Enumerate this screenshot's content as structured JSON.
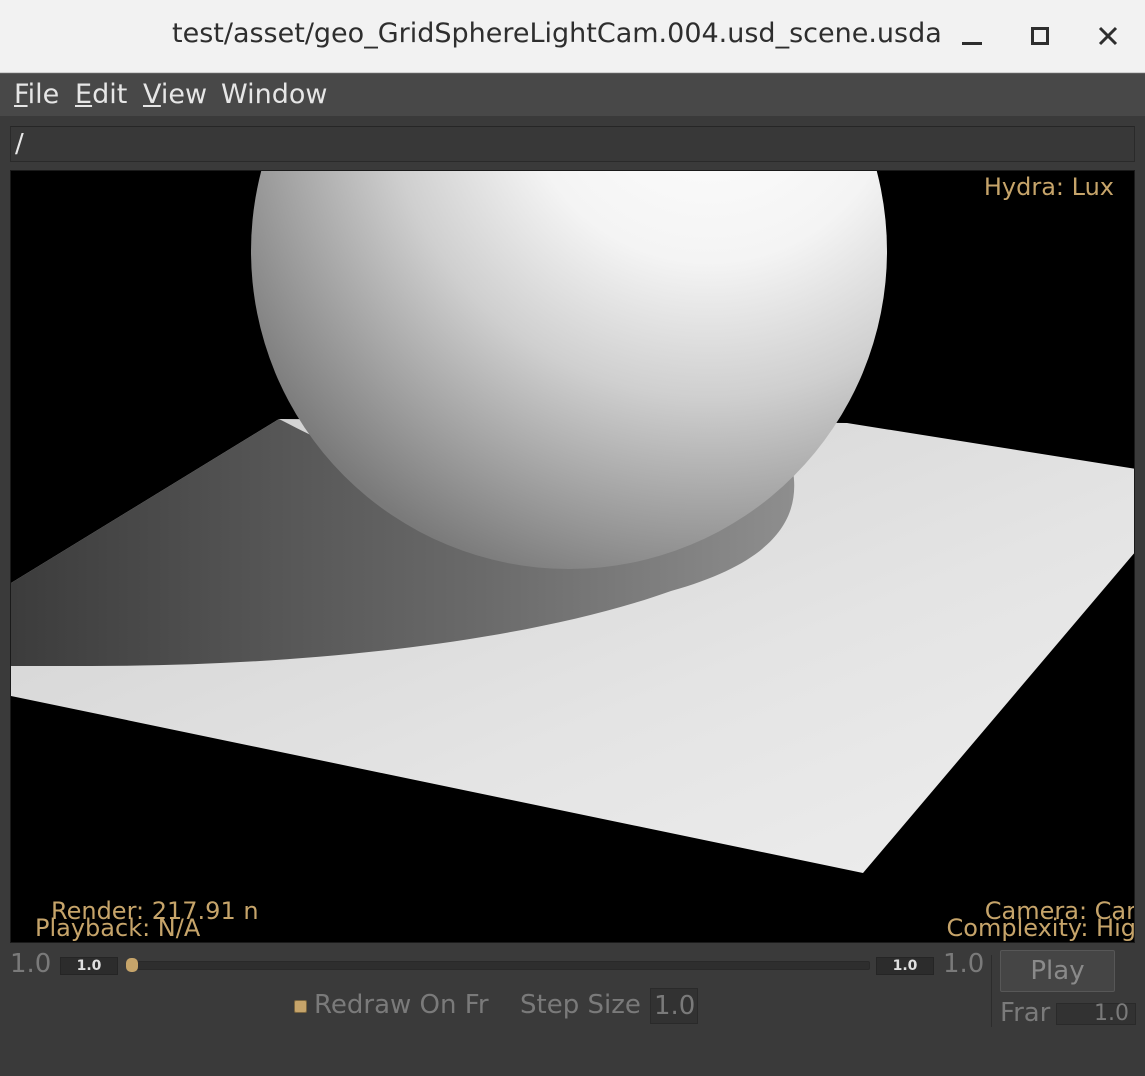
{
  "window": {
    "title": "test/asset/geo_GridSphereLightCam.004.usd_scene.usda",
    "minimize_icon": "minimize-icon",
    "maximize_icon": "maximize-icon",
    "close_icon": "close-icon"
  },
  "menubar": {
    "items": [
      {
        "mnemonic": "F",
        "rest": "ile"
      },
      {
        "mnemonic": "E",
        "rest": "dit"
      },
      {
        "mnemonic": "V",
        "rest": "iew"
      },
      {
        "mnemonic": "",
        "rest": "Window"
      }
    ]
  },
  "path": {
    "value": "/"
  },
  "viewport": {
    "renderer": "Hydra: Lux",
    "render_time": "Render: 217.91 n",
    "playback": "Playback: N/A",
    "camera": "Camera: Car",
    "complexity": "Complexity: Hig"
  },
  "timeline": {
    "start_value": "1.0",
    "start_field": "1.0",
    "end_field": "1.0",
    "end_value": "1.0",
    "progress": 0.0
  },
  "controls": {
    "play_label": "Play",
    "frame_label": "Frar",
    "frame_value": "1.0",
    "redraw_label": "Redraw On Fr",
    "redraw_checked": true,
    "step_size_label": "Step Size",
    "step_size_value": "1.0"
  },
  "colors": {
    "hud_text": "#c6a46a",
    "background": "#3a3a3a",
    "viewport_bg": "#000000"
  }
}
